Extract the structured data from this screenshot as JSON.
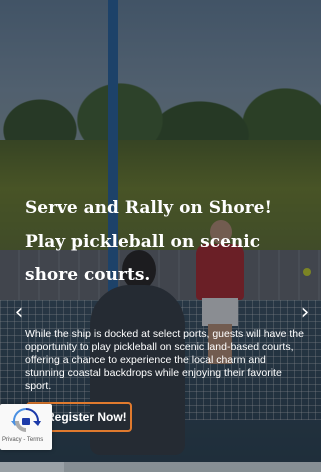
{
  "hero": {
    "headline": "Serve and Rally on Shore!",
    "subhead": "Play pickleball on scenic shore courts.",
    "body": "While the ship is docked at select ports, guests will have the opportunity to play pickleball on scenic land-based courts, offering a chance to experience the local charm and stunning coastal backdrops while enjoying their favorite sport.",
    "cta_label": "Register Now!",
    "accent_color": "#e07a2e"
  },
  "carousel": {
    "prev_glyph": "‹",
    "next_glyph": "›"
  },
  "recaptcha": {
    "legal_privacy": "Privacy",
    "legal_sep": " - ",
    "legal_terms": "Terms"
  }
}
